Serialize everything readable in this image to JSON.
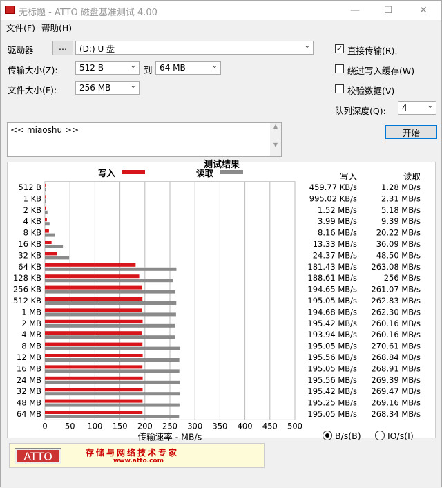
{
  "window": {
    "title": "无标题 - ATTO 磁盘基准测试 4.00"
  },
  "menu": {
    "file": "文件(F)",
    "help": "帮助(H)"
  },
  "controls": {
    "drive_label": "驱动器",
    "browse_label": "...",
    "drive_value": "(D:) U 盘",
    "transfer_size_label": "传输大小(Z):",
    "transfer_from": "512 B",
    "to_label": "到",
    "transfer_to": "64 MB",
    "file_size_label": "文件大小(F):",
    "file_size": "256 MB",
    "direct_io_label": "直接传输(R).",
    "direct_io_checked": true,
    "bypass_cache_label": "绕过写入缓存(W)",
    "bypass_cache_checked": false,
    "verify_label": "校验数据(V)",
    "verify_checked": false,
    "queue_depth_label": "队列深度(Q):",
    "queue_depth": "4",
    "start_label": "开始",
    "description": "<< miaoshu >>"
  },
  "results": {
    "title": "测试结果",
    "write_legend": "写入",
    "read_legend": "读取",
    "write_header": "写入",
    "read_header": "读取",
    "units_bs": "B/s(B)",
    "units_ios": "IO/s(I)",
    "units_selected": "B/s(B)"
  },
  "banner": {
    "logo": "ATTO",
    "tagline": "存储与网络技术专家",
    "url": "www.atto.com"
  },
  "colors": {
    "write": "#d9151c",
    "read": "#8a8a8a"
  },
  "chart_data": {
    "type": "bar",
    "orientation": "horizontal",
    "categories": [
      "512 B",
      "1 KB",
      "2 KB",
      "4 KB",
      "8 KB",
      "16 KB",
      "32 KB",
      "64 KB",
      "128 KB",
      "256 KB",
      "512 KB",
      "1 MB",
      "2 MB",
      "4 MB",
      "8 MB",
      "12 MB",
      "16 MB",
      "24 MB",
      "32 MB",
      "48 MB",
      "64 MB"
    ],
    "series": [
      {
        "name": "写入",
        "values": [
          0.45,
          0.97,
          1.52,
          3.99,
          8.16,
          13.33,
          24.37,
          181.43,
          188.61,
          194.65,
          195.05,
          194.68,
          195.42,
          193.94,
          195.05,
          195.56,
          195.05,
          195.56,
          195.42,
          195.25,
          195.05
        ]
      },
      {
        "name": "读取",
        "values": [
          1.28,
          2.31,
          5.18,
          9.39,
          20.22,
          36.09,
          48.5,
          263.08,
          256,
          261.07,
          262.83,
          262.3,
          260.16,
          260.16,
          270.61,
          268.84,
          268.91,
          269.39,
          269.47,
          269.16,
          268.34
        ]
      }
    ],
    "write_labels": [
      "459.77 KB/s",
      "995.02 KB/s",
      "1.52 MB/s",
      "3.99 MB/s",
      "8.16 MB/s",
      "13.33 MB/s",
      "24.37 MB/s",
      "181.43 MB/s",
      "188.61 MB/s",
      "194.65 MB/s",
      "195.05 MB/s",
      "194.68 MB/s",
      "195.42 MB/s",
      "193.94 MB/s",
      "195.05 MB/s",
      "195.56 MB/s",
      "195.05 MB/s",
      "195.56 MB/s",
      "195.42 MB/s",
      "195.25 MB/s",
      "195.05 MB/s"
    ],
    "read_labels": [
      "1.28 MB/s",
      "2.31 MB/s",
      "5.18 MB/s",
      "9.39 MB/s",
      "20.22 MB/s",
      "36.09 MB/s",
      "48.50 MB/s",
      "263.08 MB/s",
      "256 MB/s",
      "261.07 MB/s",
      "262.83 MB/s",
      "262.30 MB/s",
      "260.16 MB/s",
      "260.16 MB/s",
      "270.61 MB/s",
      "268.84 MB/s",
      "268.91 MB/s",
      "269.39 MB/s",
      "269.47 MB/s",
      "269.16 MB/s",
      "268.34 MB/s"
    ],
    "xlabel": "传输速率 - MB/s",
    "xticks": [
      "0",
      "50",
      "100",
      "150",
      "200",
      "250",
      "300",
      "350",
      "400",
      "450",
      "500"
    ],
    "xlim": [
      0,
      500
    ],
    "grid": true
  }
}
